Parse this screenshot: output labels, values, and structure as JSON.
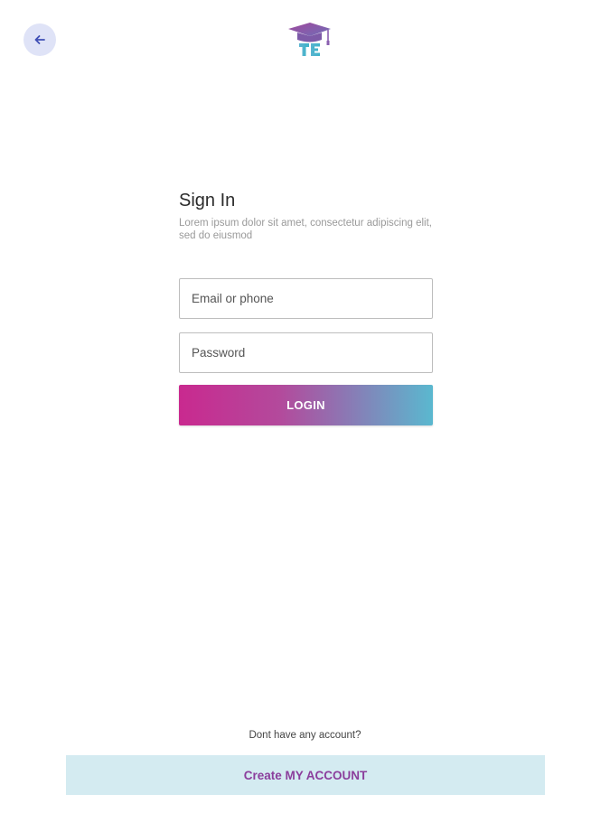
{
  "header": {
    "back_icon": "arrow-left-icon",
    "logo_icon": "graduation-cap-logo-icon"
  },
  "signin": {
    "title": "Sign In",
    "subtitle": "Lorem ipsum dolor sit amet, consectetur adipiscing elit, sed do eiusmod",
    "email_placeholder": "Email or phone",
    "email_value": "",
    "password_placeholder": "Password",
    "password_value": "",
    "login_label": "LOGIN"
  },
  "footer": {
    "prompt": "Dont have any account?",
    "create_account_label": "Create MY ACCOUNT"
  },
  "colors": {
    "back_button_bg": "#dfe3f7",
    "back_arrow": "#3f4fb5",
    "login_gradient_start": "#c9298f",
    "login_gradient_end": "#5ab8cf",
    "create_account_bg": "#d4ebf1",
    "create_account_text": "#8b3e9c"
  }
}
